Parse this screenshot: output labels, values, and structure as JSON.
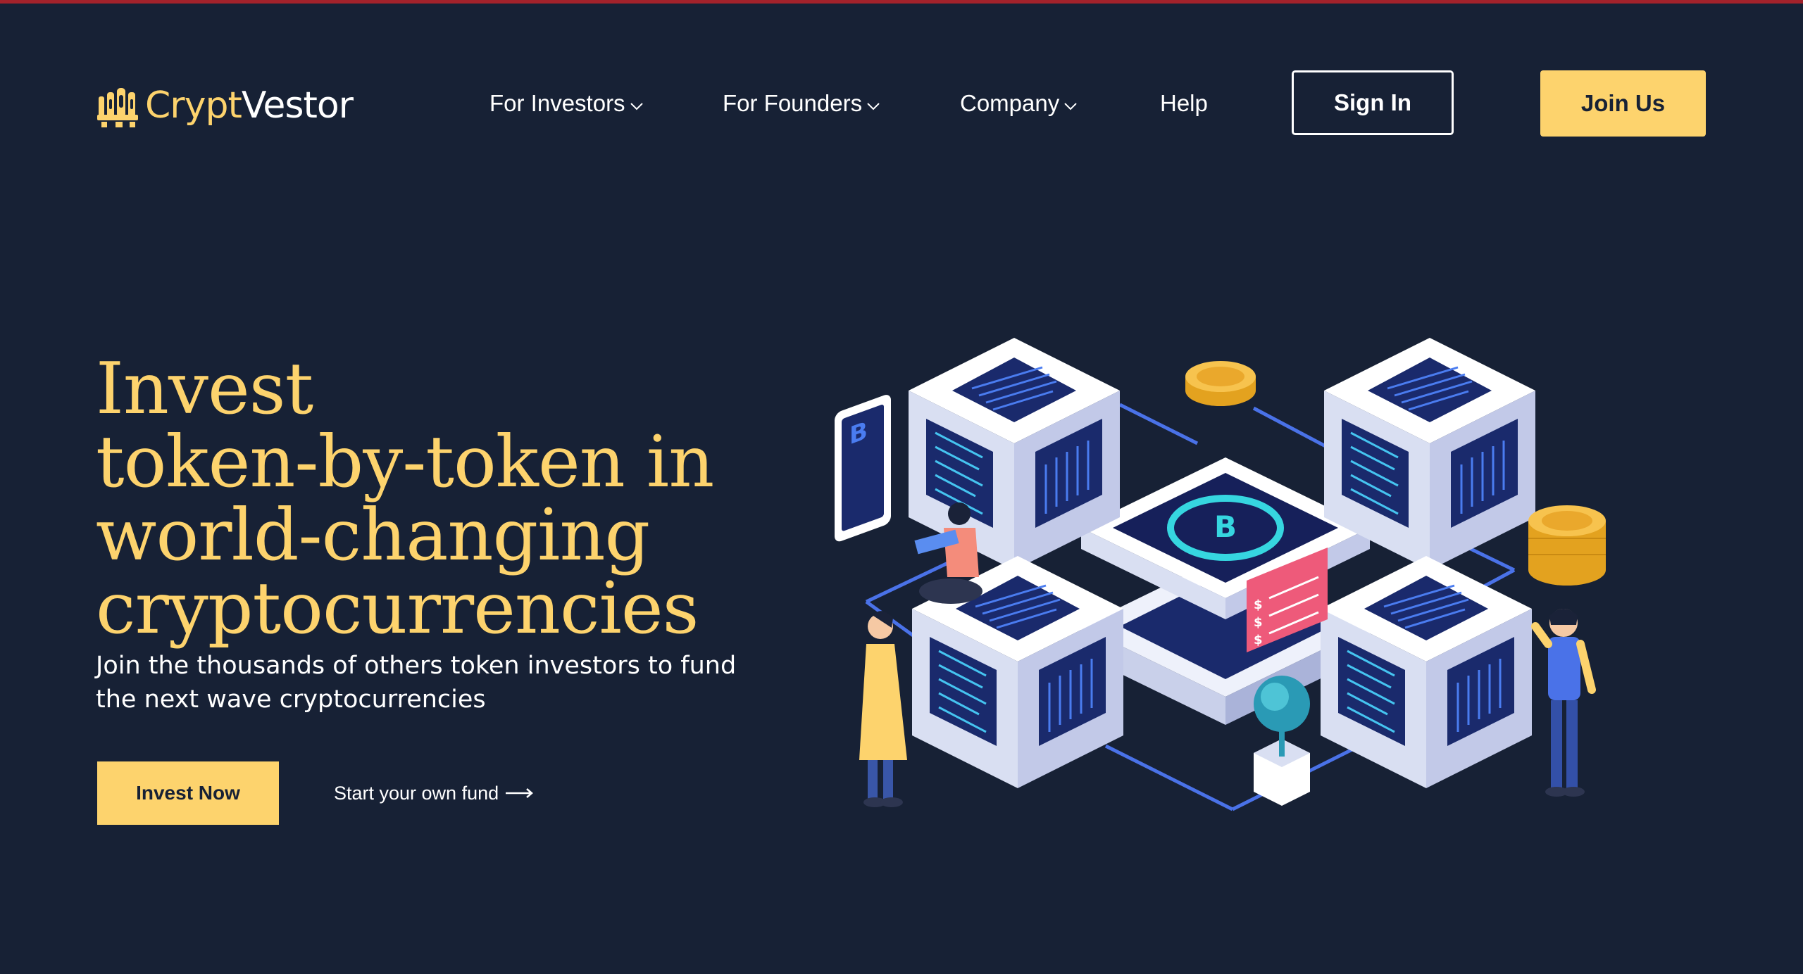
{
  "brand": {
    "name_part1": "Crypt",
    "name_part2": "Vestor",
    "accent": "#fdd36d",
    "background": "#172135"
  },
  "nav": {
    "items": [
      {
        "label": "For Investors",
        "has_dropdown": true,
        "icon": "chevron-down-icon"
      },
      {
        "label": "For Founders",
        "has_dropdown": true,
        "icon": "chevron-down-icon"
      },
      {
        "label": "Company",
        "has_dropdown": true,
        "icon": "chevron-down-icon"
      },
      {
        "label": "Help",
        "has_dropdown": false
      }
    ],
    "sign_in_label": "Sign In",
    "join_label": "Join Us"
  },
  "hero": {
    "title_lines": [
      "Invest",
      "token-by-token in",
      "world-changing",
      "cryptocurrencies"
    ],
    "subtitle_lines": [
      "Join the thousands of others token investors to fund",
      "the next wave cryptocurrencies"
    ],
    "primary_cta": "Invest Now",
    "secondary_cta": "Start your own fund",
    "secondary_icon": "arrow-right-icon"
  },
  "illustration": {
    "center_symbol": "B",
    "phone_symbol": "B",
    "receipt_symbols": [
      "$",
      "$",
      "$"
    ],
    "icons": [
      "bitcoin-server-cube",
      "gold-coin-icon",
      "coin-stack-icon",
      "phone-icon",
      "receipt-icon",
      "plant-icon"
    ]
  }
}
